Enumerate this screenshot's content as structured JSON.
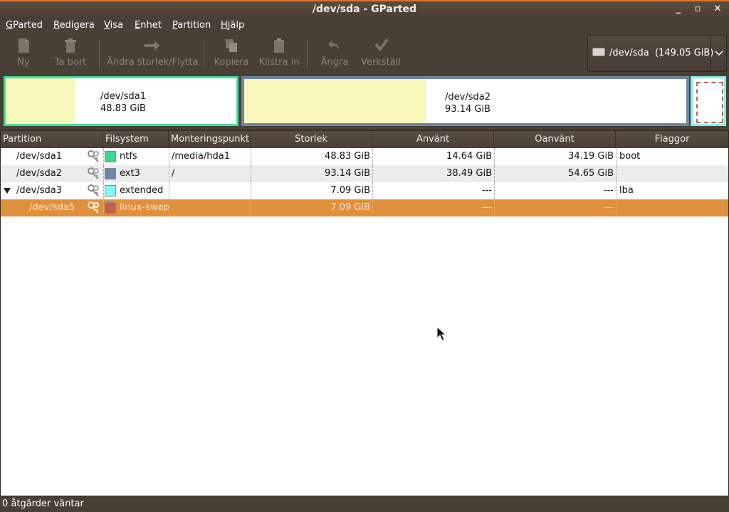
{
  "window": {
    "title": "/dev/sda - GParted",
    "minimize": "_",
    "maximize": "▫",
    "close": "✕"
  },
  "menu": [
    {
      "label": "GParted",
      "accel": "G",
      "rest": "Parted"
    },
    {
      "label": "Redigera",
      "accel": "R",
      "rest": "edigera"
    },
    {
      "label": "Visa",
      "accel": "V",
      "rest": "isa"
    },
    {
      "label": "Enhet",
      "accel": "E",
      "rest": "nhet"
    },
    {
      "label": "Partition",
      "accel": "P",
      "rest": "artition"
    },
    {
      "label": "Hjälp",
      "accel": "H",
      "rest": "jälp"
    }
  ],
  "toolbar": {
    "new": "Ny",
    "delete": "Ta bort",
    "resize": "Ändra storlek/Flytta",
    "copy": "Kopiera",
    "paste": "Klistra in",
    "undo": "Ångra",
    "apply": "Verkställ"
  },
  "device": {
    "path": "/dev/sda",
    "size": "(149.05 GiB)"
  },
  "map": {
    "sda1": {
      "name": "/dev/sda1",
      "size": "48.83 GiB",
      "used_fraction": 0.3,
      "border": "#40e0a0"
    },
    "sda2": {
      "name": "/dev/sda2",
      "size": "93.14 GiB",
      "used_fraction": 0.41,
      "border": "#6e86a6"
    },
    "extended_border": "#80f0f0",
    "swap_border": "#c0604a"
  },
  "columns": {
    "partition": "Partition",
    "filesystem": "Filsystem",
    "mountpoint": "Monteringspunkt",
    "size": "Storlek",
    "used": "Använt",
    "unused": "Oanvänt",
    "flags": "Flaggor"
  },
  "rows": [
    {
      "partition": "/dev/sda1",
      "fs": "ntfs",
      "color": "#3cd890",
      "mount": "/media/hda1",
      "size": "48.83 GiB",
      "used": "14.64 GiB",
      "unused": "34.19 GiB",
      "flags": "boot"
    },
    {
      "partition": "/dev/sda2",
      "fs": "ext3",
      "color": "#6b86a8",
      "mount": "/",
      "size": "93.14 GiB",
      "used": "38.49 GiB",
      "unused": "54.65 GiB",
      "flags": ""
    },
    {
      "partition": "/dev/sda3",
      "fs": "extended",
      "color": "#80f8f8",
      "mount": "",
      "size": "7.09 GiB",
      "used": "---",
      "unused": "---",
      "flags": "lba"
    },
    {
      "partition": "/dev/sda5",
      "fs": "linux-swap",
      "color": "#c0604a",
      "mount": "",
      "size": "7.09 GiB",
      "used": "---",
      "unused": "---",
      "flags": ""
    }
  ],
  "status": "0 åtgärder väntar"
}
